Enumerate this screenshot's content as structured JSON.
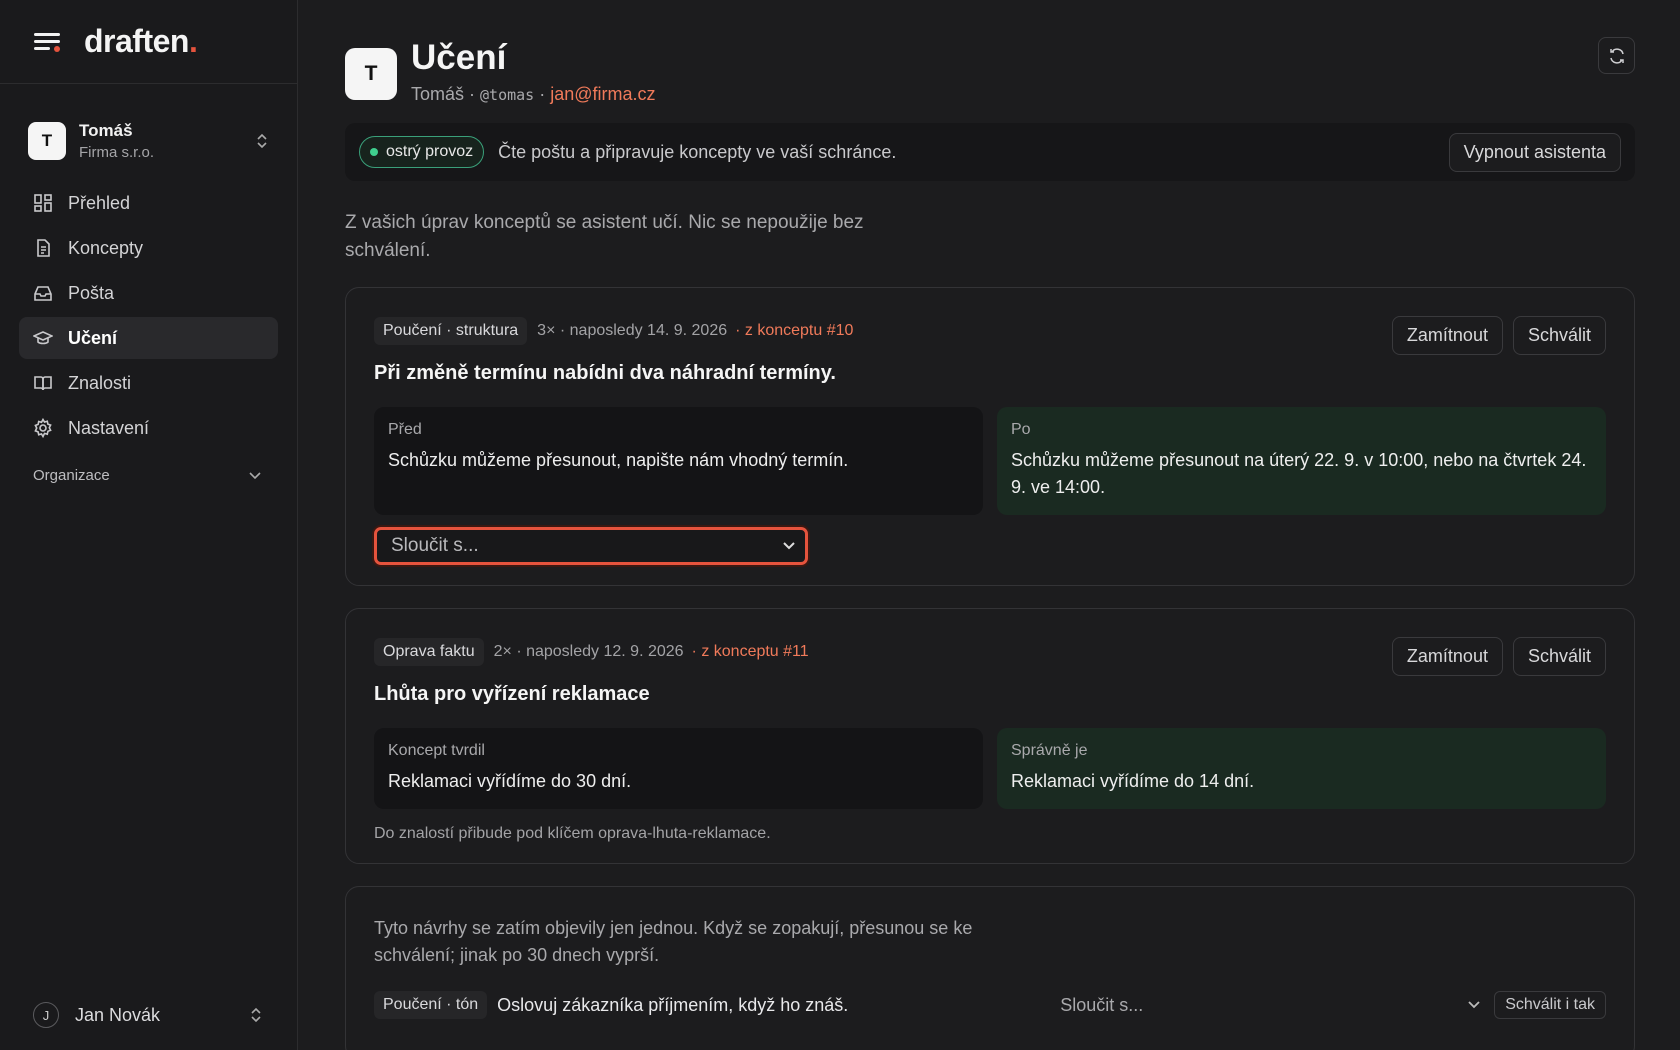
{
  "brand": {
    "name": "draften",
    "dot": "."
  },
  "account": {
    "initial": "T",
    "name": "Tomáš",
    "org": "Firma s.r.o."
  },
  "nav": [
    {
      "label": "Přehled",
      "icon": "grid-icon"
    },
    {
      "label": "Koncepty",
      "icon": "document-icon"
    },
    {
      "label": "Pošta",
      "icon": "inbox-icon"
    },
    {
      "label": "Učení",
      "icon": "graduation-cap-icon",
      "active": true
    },
    {
      "label": "Znalosti",
      "icon": "book-icon"
    },
    {
      "label": "Nastavení",
      "icon": "gear-icon"
    }
  ],
  "org_section": {
    "label": "Organizace"
  },
  "user": {
    "initial": "J",
    "name": "Jan Novák"
  },
  "header": {
    "initial": "T",
    "title": "Učení",
    "name": "Tomáš",
    "handle": "@tomas",
    "email": "jan@firma.cz",
    "sep": " · "
  },
  "status": {
    "badge": "ostrý provoz",
    "text": "Čte poštu a připravuje koncepty ve vaší schránce.",
    "button": "Vypnout asistenta"
  },
  "intro": "Z vašich úprav konceptů se asistent učí. Nic se nepoužije bez schválení.",
  "cards": [
    {
      "tag": "Poučení · struktura",
      "count": "3×",
      "last": "· naposledy 14. 9. 2026",
      "source": "· z konceptu #10",
      "reject": "Zamítnout",
      "approve": "Schválit",
      "title": "Při změně termínu nabídni dva náhradní termíny.",
      "before_label": "Před",
      "before_text": "Schůzku můžeme přesunout, napište nám vhodný termín.",
      "after_label": "Po",
      "after_text": "Schůzku můžeme přesunout na úterý 22. 9. v 10:00, nebo na čtvrtek 24. 9. ve 14:00.",
      "merge_placeholder": "Sloučit s..."
    },
    {
      "tag": "Oprava faktu",
      "count": "2×",
      "last": "· naposledy 12. 9. 2026",
      "source": "· z konceptu #11",
      "reject": "Zamítnout",
      "approve": "Schválit",
      "title": "Lhůta pro vyřízení reklamace",
      "before_label": "Koncept tvrdil",
      "before_text": "Reklamaci vyřídíme do 30 dní.",
      "after_label": "Správně je",
      "after_text": "Reklamaci vyřídíme do 14 dní.",
      "note": "Do znalostí přibude pod klíčem oprava-lhuta-reklamace."
    }
  ],
  "pending": {
    "text": "Tyto návrhy se zatím objevily jen jednou. Když se zopakují, přesunou se ke schválení; jinak po 30 dnech vyprší.",
    "row": {
      "tag": "Poučení · tón",
      "text": "Oslovuj zákazníka příjmením, když ho znáš.",
      "merge": "Sloučit s...",
      "button": "Schválit i tak"
    }
  },
  "colors": {
    "accent": "#e5533d",
    "link": "#f07a5a",
    "live": "#3fcf8e"
  }
}
